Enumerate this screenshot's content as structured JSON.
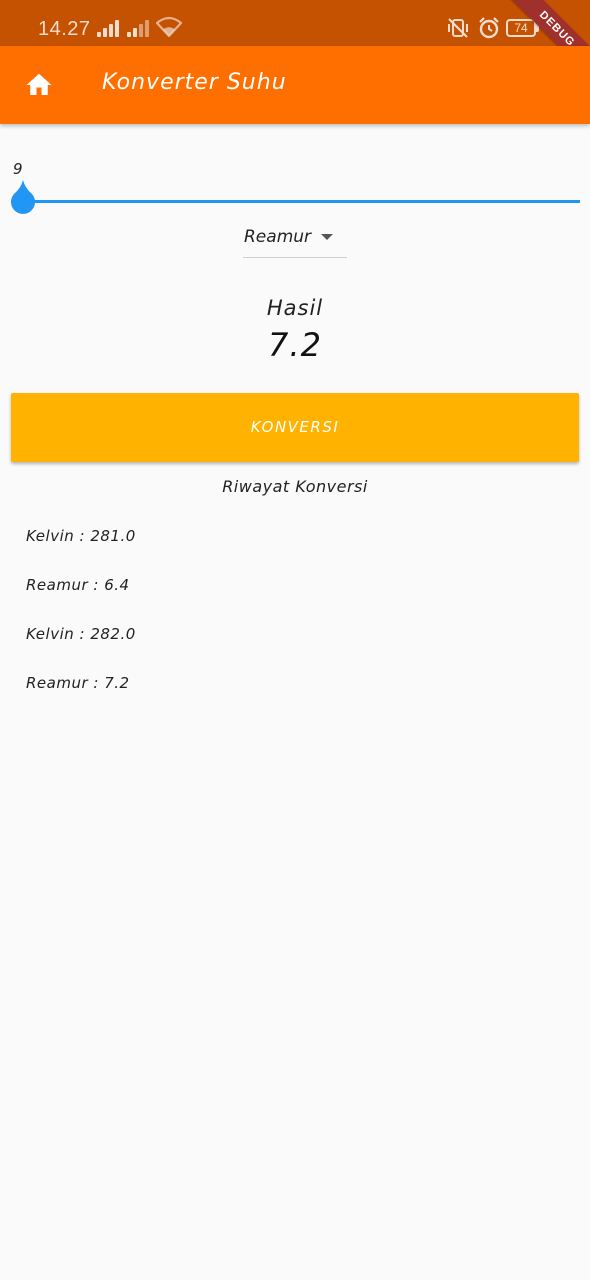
{
  "status_bar": {
    "time": "14.27",
    "battery": "74",
    "debug_label": "DEBUG"
  },
  "app_bar": {
    "title": "Konverter Suhu",
    "icon": "home-icon"
  },
  "slider": {
    "value_label": "9",
    "level_fraction": 0.0,
    "color": "#2196f3"
  },
  "dropdown": {
    "selected": "Reamur"
  },
  "result": {
    "label": "Hasil",
    "value": "7.2"
  },
  "convert_button": {
    "label": "KONVERSI",
    "color": "#ffb300"
  },
  "history": {
    "title": "Riwayat Konversi",
    "items": [
      "Kelvin : 281.0",
      "Reamur : 6.4",
      "Kelvin : 282.0",
      "Reamur : 7.2"
    ]
  },
  "colors": {
    "status_bar": "#c55200",
    "app_bar": "#ff6f00",
    "background": "#fafafa"
  }
}
